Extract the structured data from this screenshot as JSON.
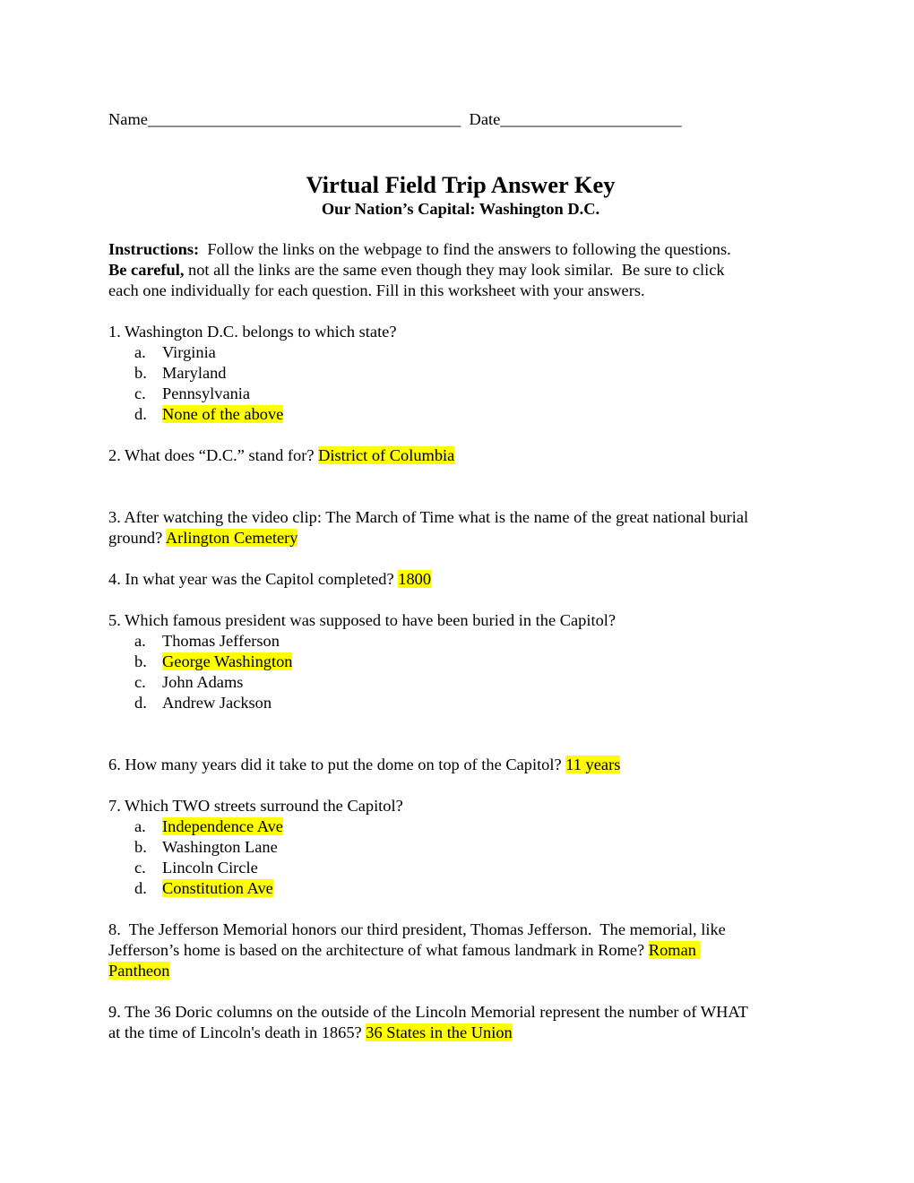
{
  "header": {
    "name_label": "Name",
    "name_blank": "______________________________________",
    "date_label": "Date",
    "date_blank": "______________________"
  },
  "title": {
    "main": "Virtual Field Trip Answer Key",
    "subtitle": "Our Nation’s Capital:  Washington D.C."
  },
  "instructions": {
    "label": "Instructions:",
    "line1_text": "  Follow the links on the webpage to find the answers to following the questions.",
    "careful_label": "Be careful,",
    "line2_text": " not all the links are the same even though they may look similar.  Be sure to click",
    "line3_text": "each one individually for each question.  Fill in this worksheet with your answers."
  },
  "highlight_color": "#ffff00",
  "questions": [
    {
      "text": "1. Washington D.C. belongs to which state?",
      "options": [
        {
          "letter": "a.",
          "text": "Virginia",
          "correct": false
        },
        {
          "letter": "b.",
          "text": "Maryland",
          "correct": false
        },
        {
          "letter": "c.",
          "text": "Pennsylvania",
          "correct": false
        },
        {
          "letter": "d.",
          "text": "None of the above",
          "correct": true
        }
      ]
    },
    {
      "text": "2. What does “D.C.” stand for? ",
      "answer": "District of Columbia"
    },
    {
      "text_line1": "3. After watching the video clip: The March of Time what is the name of the great national burial",
      "text_line2": "ground? ",
      "answer": "Arlington Cemetery"
    },
    {
      "text": "4. In what year was the Capitol completed? ",
      "answer": "1800"
    },
    {
      "text": "5.  Which famous president was supposed to have been buried in the Capitol?",
      "options": [
        {
          "letter": "a.",
          "text": "Thomas Jefferson",
          "correct": false
        },
        {
          "letter": "b.",
          "text": "George Washington",
          "correct": true
        },
        {
          "letter": "c.",
          "text": "John Adams",
          "correct": false
        },
        {
          "letter": "d.",
          "text": "Andrew Jackson",
          "correct": false
        }
      ]
    },
    {
      "text": "6. How many years did it take to put the dome on top of the Capitol? ",
      "answer": "11 years"
    },
    {
      "text": "7. Which TWO streets surround the Capitol?",
      "options": [
        {
          "letter": "a.",
          "text": "Independence Ave",
          "correct": true
        },
        {
          "letter": "b.",
          "text": "Washington Lane",
          "correct": false
        },
        {
          "letter": "c.",
          "text": "Lincoln Circle",
          "correct": false
        },
        {
          "letter": "d.",
          "text": "Constitution Ave",
          "correct": true
        }
      ]
    },
    {
      "text_line1": "8.  The Jefferson Memorial honors our third president, Thomas Jefferson.  The memorial, like",
      "text_line2": "Jefferson’s home is based on the architecture of what famous landmark in Rome? ",
      "answer_line1": "Roman ",
      "answer_line2": "Pantheon"
    },
    {
      "text_line1": "9. The 36 Doric columns on the outside of the Lincoln Memorial represent the number of WHAT",
      "text_line2": "at the time of Lincoln's death in 1865? ",
      "answer": "36 States in the Union"
    }
  ]
}
